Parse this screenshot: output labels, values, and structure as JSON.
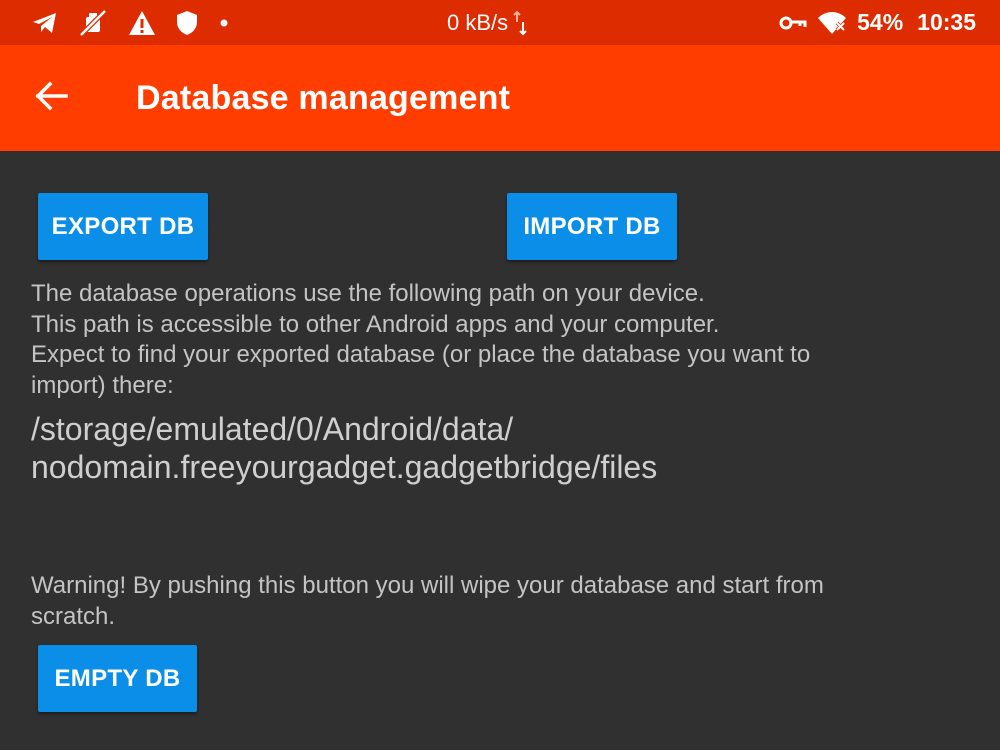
{
  "status_bar": {
    "icons_left": [
      "telegram-icon",
      "download-blocked-icon",
      "warning-icon",
      "shield-icon",
      "dot-icon"
    ],
    "network_speed": "0 kB/s",
    "icons_right": [
      "vpn-key-icon",
      "wifi-off-icon"
    ],
    "battery": "54%",
    "time": "10:35"
  },
  "app_bar": {
    "back_icon": "arrow-back-icon",
    "title": "Database management"
  },
  "buttons": {
    "export": "EXPORT DB",
    "import": "IMPORT DB",
    "empty": "EMPTY DB"
  },
  "info": {
    "lines": [
      "The database operations use the following path on your device.",
      "This path is accessible to other Android apps and your computer.",
      "Expect to find your exported database (or place the database you want to",
      "import) there:"
    ]
  },
  "path": {
    "lines": [
      "/storage/emulated/0/Android/data/",
      "nodomain.freeyourgadget.gadgetbridge/files"
    ]
  },
  "warning": {
    "lines": [
      "Warning! By pushing this button you will wipe your database and start from",
      "scratch."
    ]
  },
  "colors": {
    "status_bar": "#dc2c00",
    "app_bar": "#ff3d00",
    "background": "#303030",
    "button": "#0b8ee8"
  }
}
